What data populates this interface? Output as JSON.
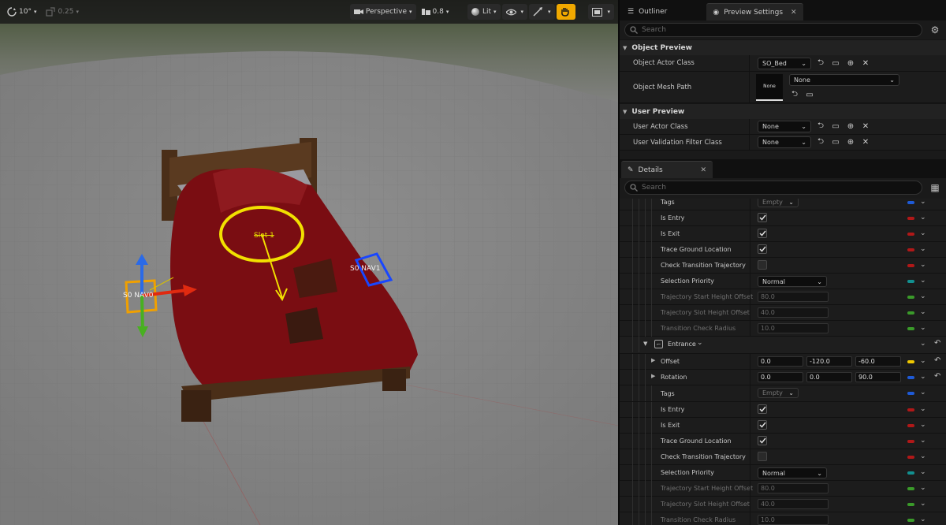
{
  "viewport": {
    "toolbar": {
      "rotation_snap": "10°",
      "scale_snap": "0.25",
      "view_mode": "Perspective",
      "camera_speed": "0.8",
      "lighting": "Lit"
    },
    "labels": {
      "slot": "Slot 1",
      "nav0": "S0 NAV0",
      "nav1": "S0 NAV1"
    }
  },
  "top_panel": {
    "tabs": [
      {
        "label": "Outliner"
      },
      {
        "label": "Preview Settings"
      }
    ],
    "search_placeholder": "Search",
    "object_preview": {
      "title": "Object Preview",
      "actor_class_label": "Object Actor Class",
      "actor_class_value": "SO_Bed",
      "mesh_path_label": "Object Mesh Path",
      "mesh_thumb": "None",
      "mesh_value": "None"
    },
    "user_preview": {
      "title": "User Preview",
      "actor_class_label": "User Actor Class",
      "actor_class_value": "None",
      "filter_label": "User Validation Filter Class",
      "filter_value": "None"
    }
  },
  "details": {
    "tab": "Details",
    "search_placeholder": "Search",
    "block1": {
      "tags_label": "Tags",
      "tags_value": "Empty",
      "is_entry": "Is Entry",
      "is_exit": "Is Exit",
      "trace_ground": "Trace Ground Location",
      "check_transition": "Check Transition Trajectory",
      "selection_priority": "Selection Priority",
      "selection_value": "Normal",
      "traj_start": "Trajectory Start Height Offset",
      "traj_start_value": "80.0",
      "traj_slot": "Trajectory Slot Height Offset",
      "traj_slot_value": "40.0",
      "transition_radius": "Transition Check Radius",
      "transition_radius_value": "10.0"
    },
    "entrance": {
      "title": "Entrance",
      "offset_label": "Offset",
      "offset": [
        "0.0",
        "-120.0",
        "-60.0"
      ],
      "rotation_label": "Rotation",
      "rotation": [
        "0.0",
        "0.0",
        "90.0"
      ],
      "tags_label": "Tags",
      "tags_value": "Empty",
      "is_entry": "Is Entry",
      "is_exit": "Is Exit",
      "trace_ground": "Trace Ground Location",
      "check_transition": "Check Transition Trajectory",
      "selection_priority": "Selection Priority",
      "selection_value": "Normal",
      "traj_start": "Trajectory Start Height Offset",
      "traj_start_value": "80.0",
      "traj_slot": "Trajectory Slot Height Offset",
      "traj_slot_value": "40.0",
      "transition_radius": "Transition Check Radius",
      "transition_radius_value": "10.0"
    }
  },
  "colors": {
    "accent": "#f0a800",
    "pill_blue": "#1e5ad6",
    "pill_red": "#b01818",
    "pill_teal": "#129090",
    "pill_green": "#3a9a2a",
    "pill_yellow": "#f0c800"
  }
}
